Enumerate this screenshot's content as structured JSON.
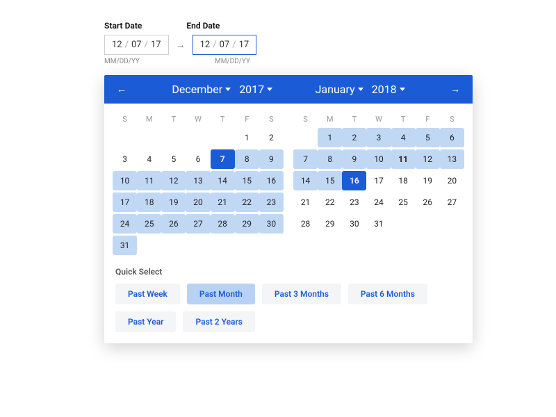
{
  "inputs": {
    "startLabel": "Start Date",
    "endLabel": "End Date",
    "start": {
      "mm": "12",
      "dd": "07",
      "yy": "17"
    },
    "end": {
      "mm": "12",
      "dd": "07",
      "yy": "17"
    },
    "format": "MM/DD/YY"
  },
  "header": {
    "left": {
      "month": "December",
      "year": "2017"
    },
    "right": {
      "month": "January",
      "year": "2018"
    }
  },
  "dow": [
    "S",
    "M",
    "T",
    "W",
    "T",
    "F",
    "S"
  ],
  "leftCalendar": {
    "weeks": [
      [
        {
          "n": ""
        },
        {
          "n": ""
        },
        {
          "n": ""
        },
        {
          "n": ""
        },
        {
          "n": ""
        },
        {
          "n": "1"
        },
        {
          "n": "2"
        }
      ],
      [
        {
          "n": "3"
        },
        {
          "n": "4"
        },
        {
          "n": "5"
        },
        {
          "n": "6"
        },
        {
          "n": "7",
          "selected": true
        },
        {
          "n": "8",
          "range": true
        },
        {
          "n": "9",
          "range": true
        }
      ],
      [
        {
          "n": "10",
          "range": true
        },
        {
          "n": "11",
          "range": true
        },
        {
          "n": "12",
          "range": true
        },
        {
          "n": "13",
          "range": true
        },
        {
          "n": "14",
          "range": true
        },
        {
          "n": "15",
          "range": true
        },
        {
          "n": "16",
          "range": true
        }
      ],
      [
        {
          "n": "17",
          "range": true
        },
        {
          "n": "18",
          "range": true
        },
        {
          "n": "19",
          "range": true
        },
        {
          "n": "20",
          "range": true
        },
        {
          "n": "21",
          "range": true
        },
        {
          "n": "22",
          "range": true
        },
        {
          "n": "23",
          "range": true
        }
      ],
      [
        {
          "n": "24",
          "range": true
        },
        {
          "n": "25",
          "range": true
        },
        {
          "n": "26",
          "range": true
        },
        {
          "n": "27",
          "range": true
        },
        {
          "n": "28",
          "range": true
        },
        {
          "n": "29",
          "range": true
        },
        {
          "n": "30",
          "range": true
        }
      ],
      [
        {
          "n": "31",
          "range": true
        },
        {
          "n": ""
        },
        {
          "n": ""
        },
        {
          "n": ""
        },
        {
          "n": ""
        },
        {
          "n": ""
        },
        {
          "n": ""
        }
      ]
    ]
  },
  "rightCalendar": {
    "weeks": [
      [
        {
          "n": ""
        },
        {
          "n": "1",
          "range": true
        },
        {
          "n": "2",
          "range": true
        },
        {
          "n": "3",
          "range": true
        },
        {
          "n": "4",
          "range": true
        },
        {
          "n": "5",
          "range": true
        },
        {
          "n": "6",
          "range": true
        }
      ],
      [
        {
          "n": "7",
          "range": true
        },
        {
          "n": "8",
          "range": true
        },
        {
          "n": "9",
          "range": true
        },
        {
          "n": "10",
          "range": true
        },
        {
          "n": "11",
          "range": true,
          "bold": true
        },
        {
          "n": "12",
          "range": true
        },
        {
          "n": "13",
          "range": true
        }
      ],
      [
        {
          "n": "14",
          "range": true
        },
        {
          "n": "15",
          "range": true
        },
        {
          "n": "16",
          "selected": true
        },
        {
          "n": "17"
        },
        {
          "n": "18"
        },
        {
          "n": "19"
        },
        {
          "n": "20"
        }
      ],
      [
        {
          "n": "21"
        },
        {
          "n": "22"
        },
        {
          "n": "23"
        },
        {
          "n": "24"
        },
        {
          "n": "25"
        },
        {
          "n": "26"
        },
        {
          "n": "27"
        }
      ],
      [
        {
          "n": "28"
        },
        {
          "n": "29"
        },
        {
          "n": "30"
        },
        {
          "n": "31"
        },
        {
          "n": ""
        },
        {
          "n": ""
        },
        {
          "n": ""
        }
      ]
    ]
  },
  "quickSelect": {
    "title": "Quick Select",
    "options": [
      {
        "label": "Past Week"
      },
      {
        "label": "Past Month",
        "active": true
      },
      {
        "label": "Past 3 Months"
      },
      {
        "label": "Past 6 Months"
      },
      {
        "label": "Past Year"
      },
      {
        "label": "Past 2 Years"
      }
    ]
  }
}
